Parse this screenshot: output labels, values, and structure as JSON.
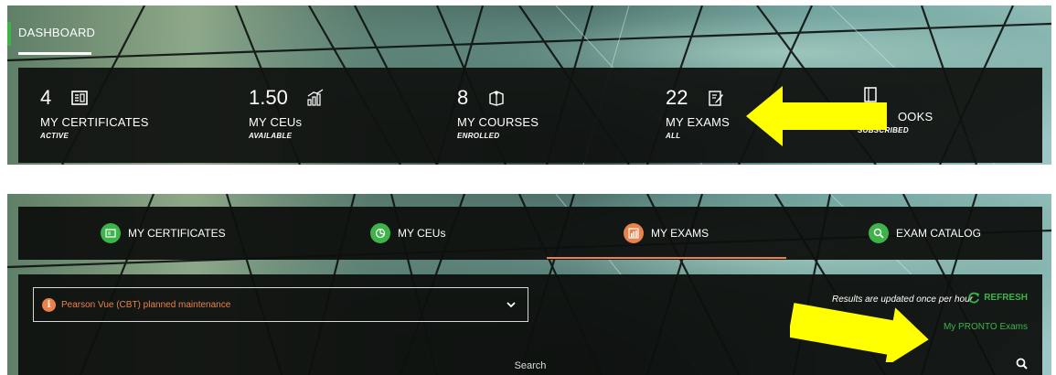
{
  "dashboard": {
    "label": "DASHBOARD"
  },
  "stats": [
    {
      "value": "4",
      "label": "MY CERTIFICATES",
      "sub": "ACTIVE",
      "icon": "certificate-icon"
    },
    {
      "value": "1.50",
      "label": "MY CEUs",
      "sub": "AVAILABLE",
      "icon": "growth-chart-icon"
    },
    {
      "value": "8",
      "label": "MY COURSES",
      "sub": "ENROLLED",
      "icon": "courses-icon"
    },
    {
      "value": "22",
      "label": "MY EXAMS",
      "sub": "ALL",
      "icon": "exam-edit-icon"
    },
    {
      "value": "",
      "label": "OOKS",
      "sub": "SUBSCRIBED",
      "icon": "book-icon"
    }
  ],
  "tabs": [
    {
      "label": "MY CERTIFICATES",
      "icon": "certificate-icon",
      "color": "#3db34a"
    },
    {
      "label": "MY CEUs",
      "icon": "pie-chart-icon",
      "color": "#3db34a"
    },
    {
      "label": "MY EXAMS",
      "icon": "bar-chart-icon",
      "color": "#e8814a",
      "active": true
    },
    {
      "label": "EXAM CATALOG",
      "icon": "search-icon",
      "color": "#3db34a"
    }
  ],
  "exams": {
    "maintenance_notice": "Pearson Vue (CBT) planned maintenance",
    "results_note": "Results are updated  once per hour",
    "refresh_label": "REFRESH",
    "pronto_link": "My PRONTO Exams",
    "search_placeholder": "Search"
  },
  "colors": {
    "accent_green": "#3db34a",
    "accent_orange": "#e8814a",
    "highlight_arrow": "#ffff00"
  }
}
